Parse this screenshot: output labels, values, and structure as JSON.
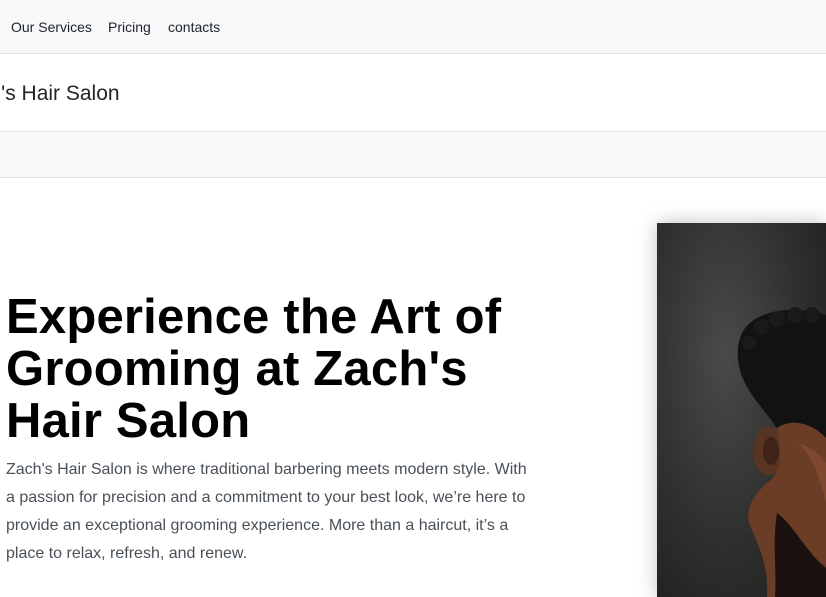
{
  "topnav": {
    "items": [
      "Our Services",
      "Pricing",
      "contacts"
    ]
  },
  "brand": {
    "name": "ch's Hair Salon"
  },
  "hero": {
    "title": "Experience the Art of Grooming at Zach's Hair Salon",
    "description": "Zach's Hair Salon is where traditional barbering meets modern style. With a passion for precision and a commitment to your best look, we’re here to provide an exceptional grooming experience. More than a haircut, it’s a place to relax, refresh, and renew.",
    "image": "barber-client-portrait"
  },
  "colors": {
    "nav_bg": "#f8f9fa",
    "border": "#dee2e6",
    "text": "#212529",
    "muted": "#495057"
  }
}
